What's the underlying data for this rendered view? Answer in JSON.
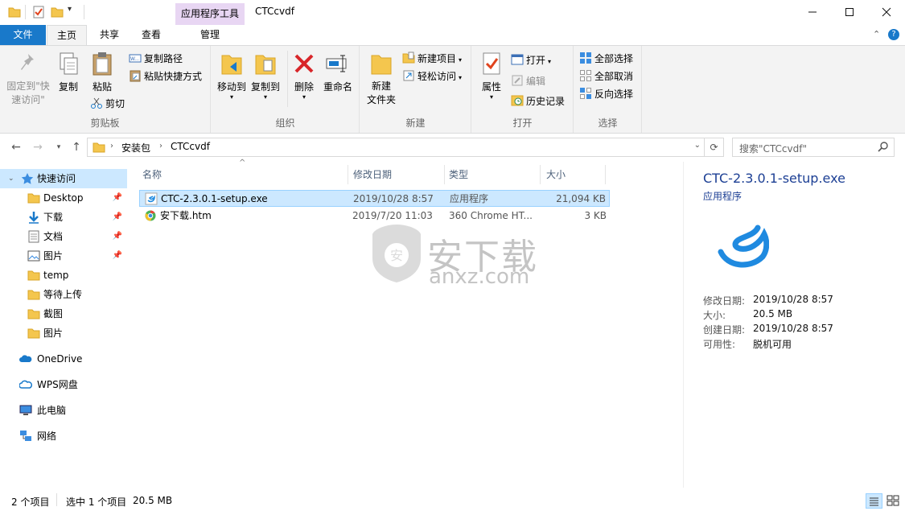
{
  "window": {
    "title": "CTCcvdf",
    "context_tab_group": "应用程序工具"
  },
  "tabs": {
    "file": "文件",
    "home": "主页",
    "share": "共享",
    "view": "查看",
    "manage": "管理"
  },
  "ribbon": {
    "clipboard": {
      "pin_quick_access": "固定到\"快速访问\"",
      "copy": "复制",
      "paste": "粘贴",
      "copy_path": "复制路径",
      "paste_shortcut": "粘贴快捷方式",
      "cut": "剪切",
      "group_label": "剪贴板"
    },
    "organize": {
      "move_to": "移动到",
      "copy_to": "复制到",
      "delete": "删除",
      "rename": "重命名",
      "group_label": "组织"
    },
    "new": {
      "new_folder": "新建\n文件夹",
      "new_item": "新建项目",
      "easy_access": "轻松访问",
      "group_label": "新建"
    },
    "open": {
      "properties": "属性",
      "open": "打开",
      "edit": "编辑",
      "history": "历史记录",
      "group_label": "打开"
    },
    "select": {
      "select_all": "全部选择",
      "select_none": "全部取消",
      "invert": "反向选择",
      "group_label": "选择"
    }
  },
  "address": {
    "breadcrumb": [
      "安装包",
      "CTCcvdf"
    ],
    "search_placeholder": "搜索\"CTCcvdf\""
  },
  "sidebar": {
    "items": [
      {
        "label": "快速访问",
        "icon": "star-icon",
        "pinned": false
      },
      {
        "label": "Desktop",
        "icon": "folder-icon",
        "pinned": true
      },
      {
        "label": "下载",
        "icon": "download-icon",
        "pinned": true
      },
      {
        "label": "文档",
        "icon": "document-icon",
        "pinned": true
      },
      {
        "label": "图片",
        "icon": "pictures-icon",
        "pinned": true
      },
      {
        "label": "temp",
        "icon": "folder-icon",
        "pinned": false
      },
      {
        "label": "等待上传",
        "icon": "folder-icon",
        "pinned": false
      },
      {
        "label": "截图",
        "icon": "folder-icon",
        "pinned": false
      },
      {
        "label": "图片",
        "icon": "folder-icon",
        "pinned": false
      },
      {
        "label": "OneDrive",
        "icon": "cloud-icon",
        "pinned": false
      },
      {
        "label": "WPS网盘",
        "icon": "cloud-icon",
        "pinned": false
      },
      {
        "label": "此电脑",
        "icon": "computer-icon",
        "pinned": false
      },
      {
        "label": "网络",
        "icon": "network-icon",
        "pinned": false
      }
    ]
  },
  "filelist": {
    "columns": [
      "名称",
      "修改日期",
      "类型",
      "大小"
    ],
    "rows": [
      {
        "name": "CTC-2.3.0.1-setup.exe",
        "date": "2019/10/28 8:57",
        "type": "应用程序",
        "size": "21,094 KB",
        "selected": true,
        "icon": "app-icon"
      },
      {
        "name": "安下载.htm",
        "date": "2019/7/20 11:03",
        "type": "360 Chrome HT...",
        "size": "3 KB",
        "selected": false,
        "icon": "chrome-html-icon"
      }
    ]
  },
  "preview": {
    "filename": "CTC-2.3.0.1-setup.exe",
    "filetype": "应用程序",
    "fields": [
      {
        "label": "修改日期:",
        "value": "2019/10/28 8:57"
      },
      {
        "label": "大小:",
        "value": "20.5 MB"
      },
      {
        "label": "创建日期:",
        "value": "2019/10/28 8:57"
      },
      {
        "label": "可用性:",
        "value": "脱机可用"
      }
    ]
  },
  "watermark": {
    "text": "安下载",
    "url": "anxz.com"
  },
  "status": {
    "items_count": "2 个项目",
    "selected": "选中 1 个项目",
    "size": "20.5 MB"
  },
  "colors": {
    "accent": "#1979ca",
    "context_tab": "#e8d6f3",
    "selection": "#cce8ff"
  }
}
